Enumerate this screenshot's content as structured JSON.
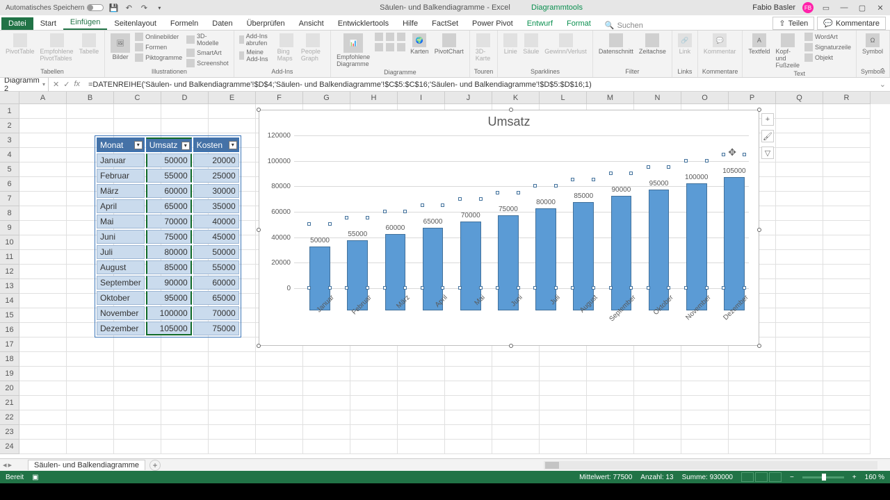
{
  "titlebar": {
    "autosave": "Automatisches Speichern",
    "doc_title": "Säulen- und Balkendiagramme - Excel",
    "chart_tools": "Diagrammtools",
    "user": "Fabio Basler",
    "avatar": "FB"
  },
  "ribbon": {
    "tabs": [
      "Datei",
      "Start",
      "Einfügen",
      "Seitenlayout",
      "Formeln",
      "Daten",
      "Überprüfen",
      "Ansicht",
      "Entwicklertools",
      "Hilfe",
      "FactSet",
      "Power Pivot",
      "Entwurf",
      "Format"
    ],
    "active_tab": "Einfügen",
    "search_placeholder": "Suchen",
    "share": "Teilen",
    "comments": "Kommentare",
    "groups": {
      "tabellen": {
        "title": "Tabellen",
        "pivot": "PivotTable",
        "empf": "Empfohlene PivotTables",
        "tab": "Tabelle"
      },
      "illustr": {
        "title": "Illustrationen",
        "bilder": "Bilder",
        "online": "Onlinebilder",
        "formen": "Formen",
        "smart": "SmartArt",
        "pikto": "Piktogramme",
        "screen": "Screenshot",
        "model3d": "3D-Modelle"
      },
      "addins": {
        "title": "Add-Ins",
        "get": "Add-Ins abrufen",
        "mine": "Meine Add-Ins",
        "bing": "Bing Maps",
        "people": "People Graph"
      },
      "diagramme": {
        "title": "Diagramme",
        "empf": "Empfohlene Diagramme",
        "karten": "Karten",
        "pivot": "PivotChart"
      },
      "touren": {
        "title": "Touren",
        "karte": "3D-Karte"
      },
      "spark": {
        "title": "Sparklines",
        "linie": "Linie",
        "saule": "Säule",
        "gewinn": "Gewinn/Verlust"
      },
      "filter": {
        "title": "Filter",
        "daten": "Datenschnitt",
        "zeit": "Zeitachse"
      },
      "links": {
        "title": "Links",
        "link": "Link"
      },
      "komm": {
        "title": "Kommentare",
        "komm": "Kommentar"
      },
      "text": {
        "title": "Text",
        "tf": "Textfeld",
        "kopf": "Kopf- und Fußzeile",
        "wa": "WordArt",
        "sig": "Signaturzeile",
        "obj": "Objekt"
      },
      "symb": {
        "title": "Symbole",
        "sym": "Symbol"
      }
    }
  },
  "namebox": "Diagramm 2",
  "formula": "=DATENREIHE('Säulen- und Balkendiagramme'!$D$4;'Säulen- und Balkendiagramme'!$C$5:$C$16;'Säulen- und Balkendiagramme'!$D$5:$D$16;1)",
  "columns": [
    "A",
    "B",
    "C",
    "D",
    "E",
    "F",
    "G",
    "H",
    "I",
    "J",
    "K",
    "L",
    "M",
    "N",
    "O",
    "P",
    "Q",
    "R"
  ],
  "table": {
    "headers": [
      "Monat",
      "Umsatz",
      "Kosten"
    ],
    "rows": [
      [
        "Januar",
        "50000",
        "20000"
      ],
      [
        "Februar",
        "55000",
        "25000"
      ],
      [
        "März",
        "60000",
        "30000"
      ],
      [
        "April",
        "65000",
        "35000"
      ],
      [
        "Mai",
        "70000",
        "40000"
      ],
      [
        "Juni",
        "75000",
        "45000"
      ],
      [
        "Juli",
        "80000",
        "50000"
      ],
      [
        "August",
        "85000",
        "55000"
      ],
      [
        "September",
        "90000",
        "60000"
      ],
      [
        "Oktober",
        "95000",
        "65000"
      ],
      [
        "November",
        "100000",
        "70000"
      ],
      [
        "Dezember",
        "105000",
        "75000"
      ]
    ]
  },
  "chart_data": {
    "type": "bar",
    "title": "Umsatz",
    "categories": [
      "Januar",
      "Februar",
      "März",
      "April",
      "Mai",
      "Juni",
      "Juli",
      "August",
      "September",
      "Oktober",
      "November",
      "Dezember"
    ],
    "values": [
      50000,
      55000,
      60000,
      65000,
      70000,
      75000,
      80000,
      85000,
      90000,
      95000,
      100000,
      105000
    ],
    "yticks": [
      0,
      20000,
      40000,
      60000,
      80000,
      100000,
      120000
    ],
    "ylim": [
      0,
      120000
    ],
    "xlabel": "",
    "ylabel": ""
  },
  "sheet_tab": "Säulen- und Balkendiagramme",
  "statusbar": {
    "ready": "Bereit",
    "avg": "Mittelwert: 77500",
    "count": "Anzahl: 13",
    "sum": "Summe: 930000",
    "zoom": "160 %"
  }
}
